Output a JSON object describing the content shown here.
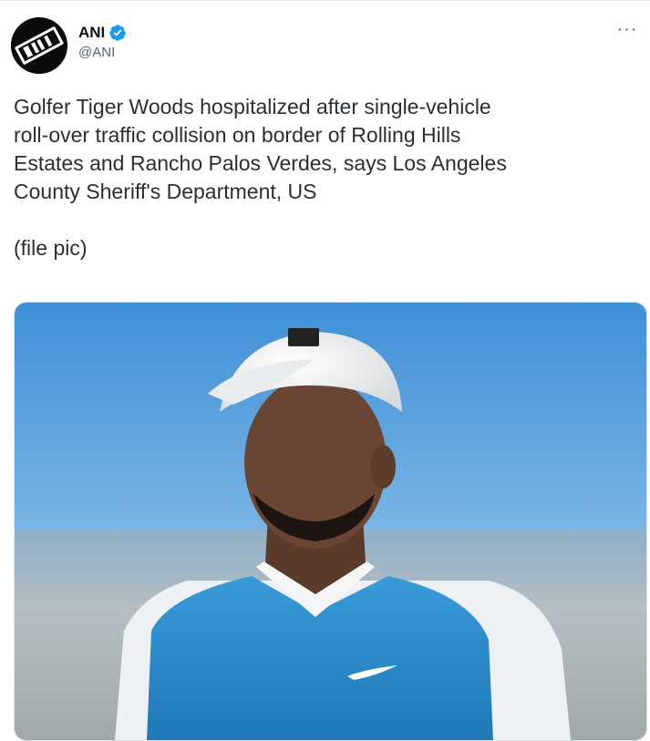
{
  "tweet": {
    "author": {
      "name": "ANI",
      "handle": "@ANI",
      "verified": true,
      "avatar_text": "ANI"
    },
    "more_icon": "more-horizontal-icon",
    "body": "Golfer Tiger Woods hospitalized after single-vehicle\nroll-over traffic collision on border of Rolling Hills\nEstates and Rancho Palos Verdes, says Los Angeles\nCounty Sheriff's Department, US\n\n(file pic)",
    "media": {
      "kind": "photo",
      "subject": "golfer-portrait"
    }
  },
  "colors": {
    "verified_blue": "#1d9bf0",
    "handle_gray": "#536471",
    "text": "#2a2f33"
  }
}
